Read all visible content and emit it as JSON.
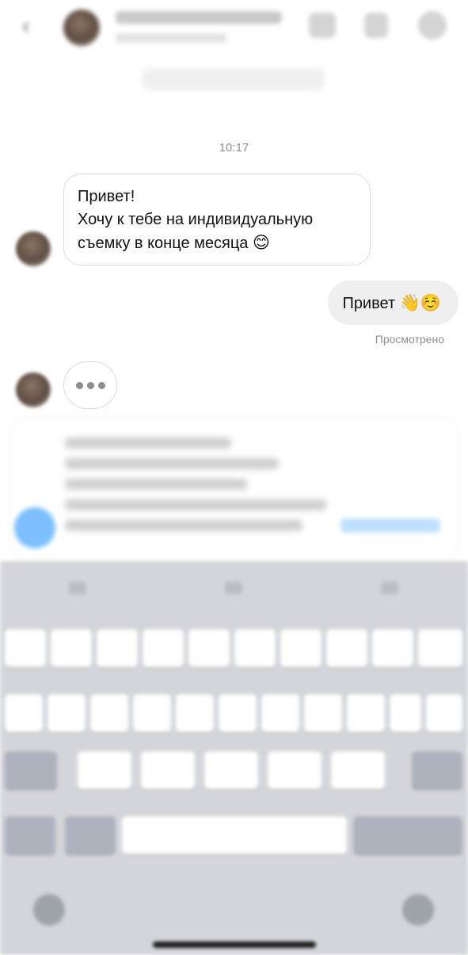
{
  "header": {
    "back_icon": "chevron-left-icon",
    "icons": [
      "video-call-icon",
      "flag-icon",
      "info-icon"
    ]
  },
  "conversation": {
    "timestamp": "10:17",
    "incoming": {
      "lines": [
        "Привет!",
        "Хочу к тебе на индивидуальную",
        "съемку в конце месяца"
      ],
      "emoji": "😊"
    },
    "outgoing": {
      "text": "Привет",
      "emoji": "👋☺️"
    },
    "seen_label": "Просмотрено"
  },
  "colors": {
    "bubble_border": "#dbdbdb",
    "outgoing_bubble": "#efefef",
    "accent": "#3897f0",
    "keyboard_bg": "#d3d5da"
  }
}
